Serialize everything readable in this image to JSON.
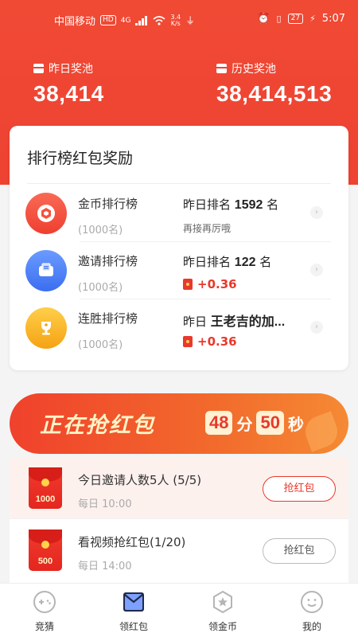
{
  "status": {
    "carrier": "中国移动",
    "hd": "HD",
    "net": "4G",
    "speed_value": "3.4",
    "speed_unit": "K/s",
    "battery": "27",
    "time": "5:07"
  },
  "pools": {
    "yesterday_label": "昨日奖池",
    "yesterday_value": "38,414",
    "history_label": "历史奖池",
    "history_value": "38,414,513"
  },
  "leaderboard": {
    "title": "排行榜红包奖励",
    "rows": [
      {
        "name": "金币排行榜",
        "sub": "(1000名)",
        "rank_prefix": "昨日排名",
        "rank_value": "1592",
        "rank_suffix": "名",
        "note": "再接再厉哦",
        "color": "#f4533f"
      },
      {
        "name": "邀请排行榜",
        "sub": "(1000名)",
        "rank_prefix": "昨日排名",
        "rank_value": "122",
        "rank_suffix": "名",
        "money": "+0.36",
        "color": "#4a7cf0"
      },
      {
        "name": "连胜排行榜",
        "sub": "(1000名)",
        "rank_prefix": "昨日",
        "rank_value": "王老吉的加...",
        "money": "+0.36",
        "color": "#f9a825"
      }
    ]
  },
  "banner": {
    "title": "正在抢红包",
    "minutes": "48",
    "min_unit": "分",
    "seconds": "50",
    "sec_unit": "秒"
  },
  "tasks": [
    {
      "amount": "1000",
      "title": "今日邀请人数5人 (5/5)",
      "sub": "每日 10:00",
      "button": "抢红包"
    },
    {
      "amount": "500",
      "title": "看视频抢红包(1/20)",
      "sub": "每日 14:00",
      "button": "抢红包"
    }
  ],
  "tabs": [
    {
      "label": "竞猜",
      "icon": "gamepad-icon"
    },
    {
      "label": "领红包",
      "icon": "envelope-icon"
    },
    {
      "label": "领金币",
      "icon": "coin-star-icon"
    },
    {
      "label": "我的",
      "icon": "smiley-icon"
    }
  ],
  "colors": {
    "brand": "#ee4232",
    "accent": "#e8392c"
  }
}
